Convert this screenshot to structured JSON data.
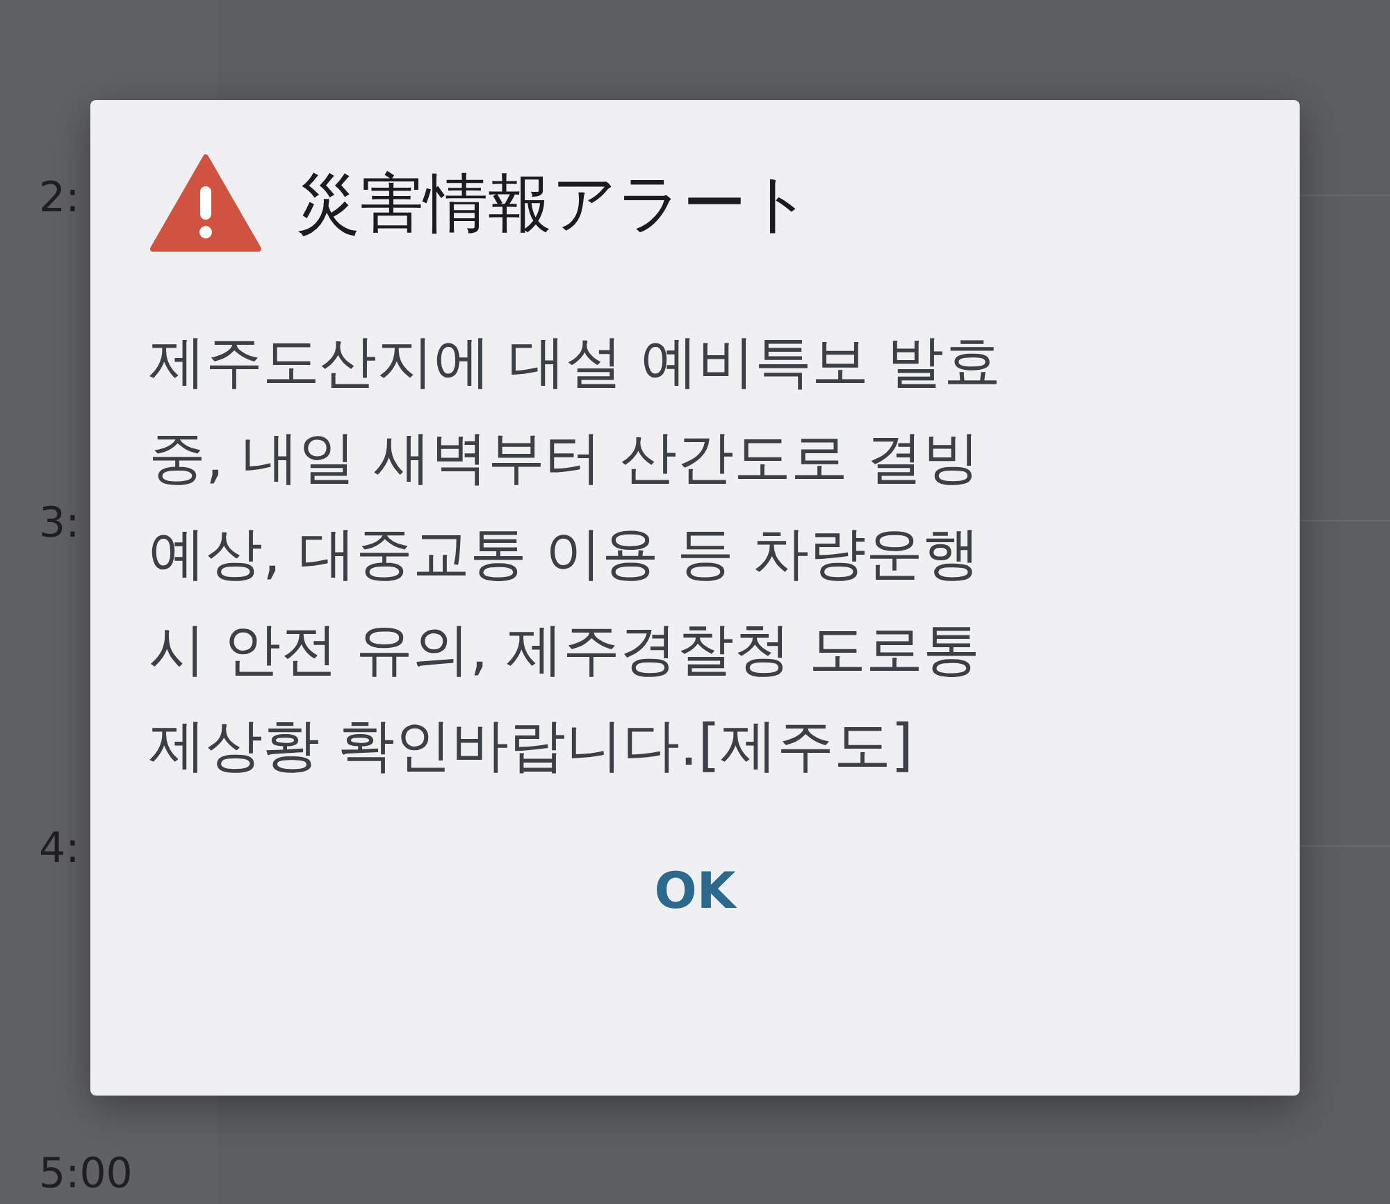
{
  "calendar": {
    "hours": [
      "2:",
      "3:",
      "4:",
      "5:00"
    ]
  },
  "alert": {
    "title": "災害情報アラート",
    "message_lines": [
      "제주도산지에 대설 예비특보 발효",
      "중, 내일 새벽부터 산간도로 결빙",
      "예상, 대중교통 이용 등 차량운행",
      "시 안전 유의, 제주경찰청 도로통",
      "제상황 확인바랍니다.[제주도]"
    ],
    "button": "OK"
  }
}
